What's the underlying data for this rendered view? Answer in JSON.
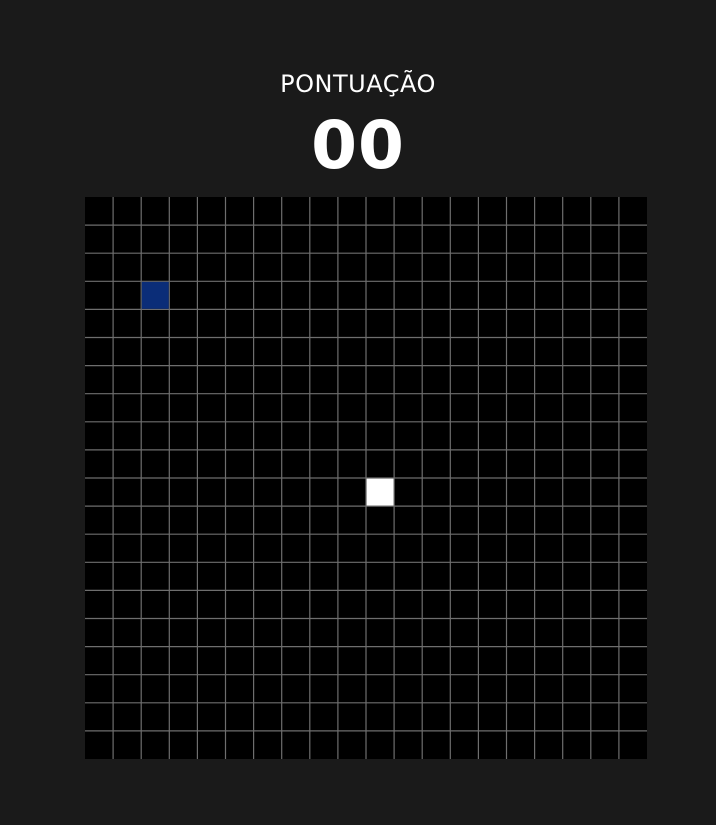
{
  "score": {
    "label": "PONTUAÇÃO",
    "value": "00"
  },
  "board": {
    "columns": 20,
    "rows": 20,
    "background_color": "#000000",
    "grid_line_color": "#6e6e6e",
    "food": {
      "col": 2,
      "row": 3,
      "color": "#0b2d78"
    },
    "snake": {
      "segments": [
        {
          "col": 10,
          "row": 10
        }
      ],
      "color": "#ffffff"
    }
  }
}
